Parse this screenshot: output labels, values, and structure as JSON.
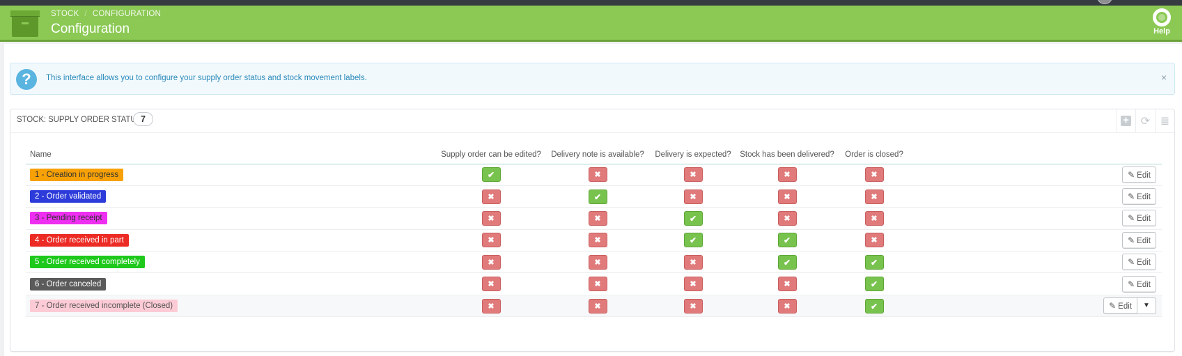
{
  "breadcrumb": {
    "item1": "STOCK",
    "separator": "/",
    "item2": "CONFIGURATION"
  },
  "page_title": "Configuration",
  "help": {
    "label": "Help",
    "icon": "lifebuoy-icon"
  },
  "alert": {
    "text": "This interface allows you to configure your supply order status and stock movement labels.",
    "close": "×"
  },
  "panel": {
    "title": "STOCK: SUPPLY ORDER STATUS",
    "count": "7",
    "tools": [
      "add-new-icon",
      "refresh-list-icon",
      "export-sql-icon"
    ]
  },
  "table": {
    "columns": [
      "Name",
      "Supply order can be edited?",
      "Delivery note is available?",
      "Delivery is expected?",
      "Stock has been delivered?",
      "Order is closed?"
    ],
    "edit_label": "Edit",
    "rows": [
      {
        "name": "1 - Creation in progress",
        "color": "#f7a107",
        "text_color": "#333333",
        "flags": [
          true,
          false,
          false,
          false,
          false
        ]
      },
      {
        "name": "2 - Order validated",
        "color": "#2c3bd9",
        "text_color": "#ffffff",
        "flags": [
          false,
          true,
          false,
          false,
          false
        ]
      },
      {
        "name": "3 - Pending receipt",
        "color": "#ee2ef0",
        "text_color": "#333333",
        "flags": [
          false,
          false,
          true,
          false,
          false
        ]
      },
      {
        "name": "4 - Order received in part",
        "color": "#ec2b24",
        "text_color": "#ffffff",
        "flags": [
          false,
          false,
          true,
          true,
          false
        ]
      },
      {
        "name": "5 - Order received completely",
        "color": "#1ec91c",
        "text_color": "#ffffff",
        "flags": [
          false,
          false,
          false,
          true,
          true
        ]
      },
      {
        "name": "6 - Order canceled",
        "color": "#5b5b5b",
        "text_color": "#ffffff",
        "flags": [
          false,
          false,
          false,
          false,
          true
        ]
      },
      {
        "name": "7 - Order received incomplete (Closed)",
        "color": "#fccbd5",
        "text_color": "#555555",
        "flags": [
          false,
          false,
          false,
          false,
          true
        ],
        "has_dropdown": true
      }
    ]
  },
  "colors": {
    "header_green": "#8bc954",
    "yes_green": "#78c24e",
    "no_red": "#e07a7b",
    "info_blue": "#2b8ab9"
  }
}
